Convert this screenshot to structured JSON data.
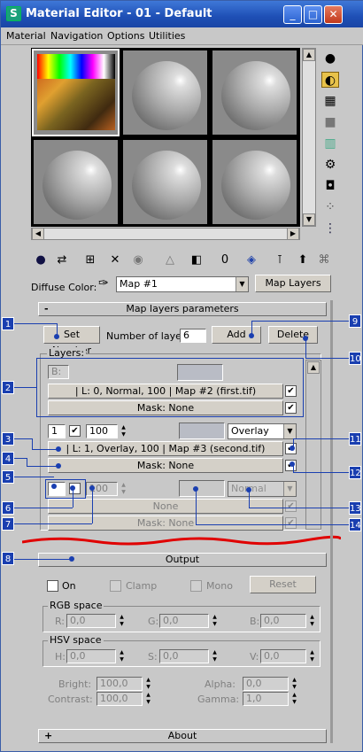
{
  "window": {
    "title": "Material Editor - 01 - Default"
  },
  "menu": [
    "Material",
    "Navigation",
    "Options",
    "Utilities"
  ],
  "diffuse": {
    "label": "Diffuse Color:",
    "map_value": "Map #1",
    "map_layers_button": "Map Layers"
  },
  "rollouts": {
    "params_title": "Map layers parameters",
    "params_toggle": "-",
    "output_title": "Output",
    "output_toggle": "",
    "about_title": "About",
    "about_toggle": "+"
  },
  "layers_controls": {
    "set_number": "Set Number",
    "num_label": "Number of layers:",
    "num_value": "6",
    "add": "Add",
    "delete": "Delete",
    "group_label": "Layers:"
  },
  "layer0": {
    "b_label": "B:",
    "name": "| L: 0, Normal, 100 | Map #2 (first.tif)",
    "mask": "Mask: None"
  },
  "layer1": {
    "index": "1",
    "opacity": "100",
    "blend": "Overlay",
    "name": "| L: 1, Overlay, 100 | Map #3 (second.tif)",
    "mask": "Mask: None"
  },
  "layer2": {
    "opacity": "100",
    "blend": "Normal",
    "name": "None",
    "mask": "Mask: None"
  },
  "output": {
    "on": "On",
    "clamp": "Clamp",
    "mono": "Mono",
    "reset": "Reset",
    "rgb_label": "RGB space",
    "r_label": "R:",
    "r_value": "0,0",
    "g_label": "G:",
    "g_value": "0,0",
    "b_label": "B:",
    "b_value": "0,0",
    "hsv_label": "HSV space",
    "h_label": "H:",
    "h_value": "0,0",
    "s_label": "S:",
    "s_value": "0,0",
    "v_label": "V:",
    "v_value": "0,0",
    "bright_label": "Bright:",
    "bright_value": "100,0",
    "contrast_label": "Contrast:",
    "contrast_value": "100,0",
    "alpha_label": "Alpha:",
    "alpha_value": "0,0",
    "gamma_label": "Gamma:",
    "gamma_value": "1,0"
  },
  "callouts": [
    "1",
    "2",
    "3",
    "4",
    "5",
    "6",
    "7",
    "8",
    "9",
    "10",
    "11",
    "12",
    "13",
    "14"
  ],
  "colors": {
    "titlebar": "#1e4fb5",
    "callout": "#1a3fb0",
    "wave": "#e00000"
  },
  "icons": {
    "app": "3ds-max-icon",
    "sphere": "sample-sphere-icon"
  }
}
